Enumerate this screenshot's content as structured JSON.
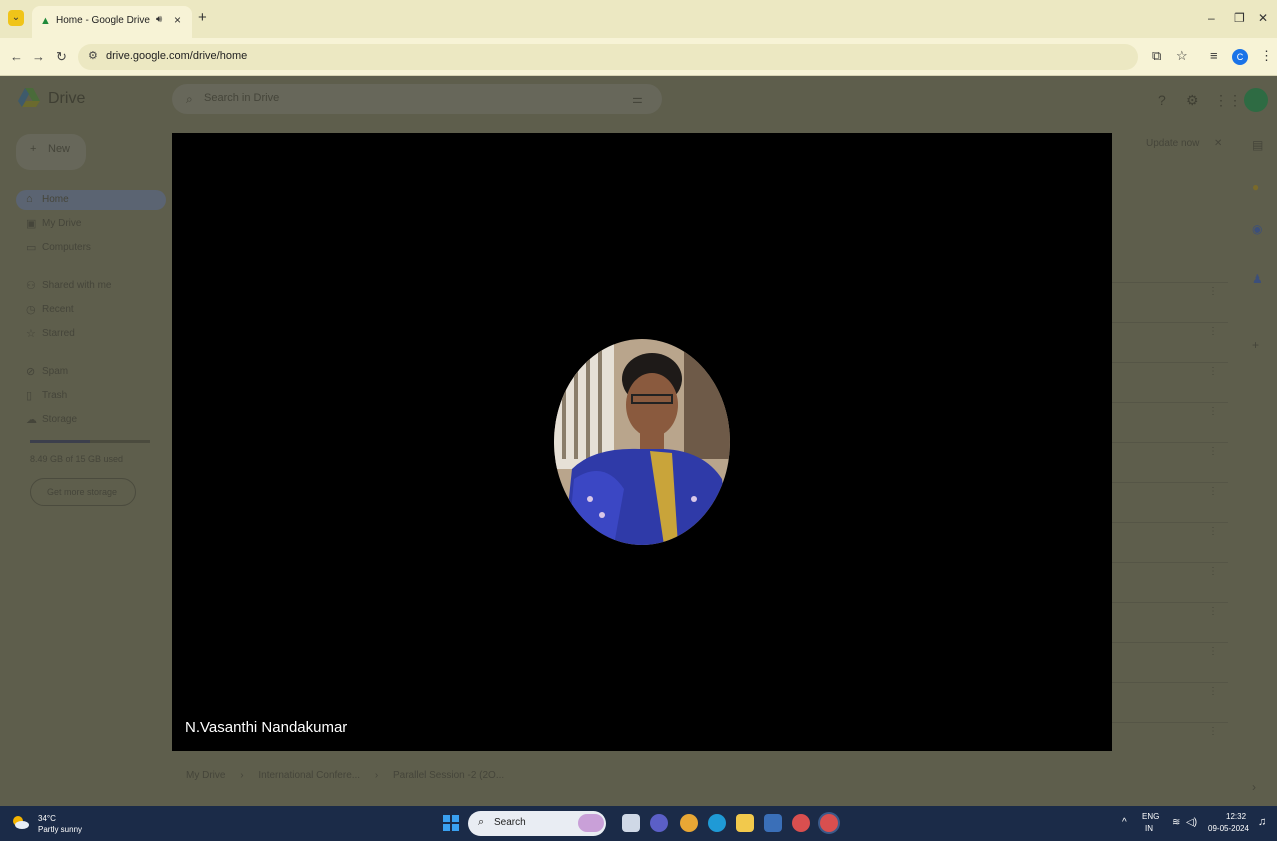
{
  "browser": {
    "tab_title": "Home - Google Drive",
    "tab_audio_icon": "speaker-icon",
    "url": "drive.google.com/drive/home",
    "window_controls": {
      "minimize": "–",
      "restore": "❐",
      "close": "✕"
    }
  },
  "drive": {
    "app_name": "Drive",
    "search_placeholder": "Search in Drive",
    "new_label": "New",
    "sidebar": [
      {
        "icon": "home-icon",
        "label": "Home"
      },
      {
        "icon": "my-drive-icon",
        "label": "My Drive"
      },
      {
        "icon": "computers-icon",
        "label": "Computers"
      },
      {
        "icon": "shared-icon",
        "label": "Shared with me"
      },
      {
        "icon": "recent-icon",
        "label": "Recent"
      },
      {
        "icon": "starred-icon",
        "label": "Starred"
      },
      {
        "icon": "spam-icon",
        "label": "Spam"
      },
      {
        "icon": "trash-icon",
        "label": "Trash"
      },
      {
        "icon": "storage-icon",
        "label": "Storage"
      }
    ],
    "storage_used": 0.5,
    "storage_text": "8.49 GB of 15 GB used",
    "storage_button": "Get more storage",
    "banner_update": "Update now",
    "breadcrumb": [
      "My Drive",
      "International Confere...",
      "Parallel Session -2 (2O..."
    ]
  },
  "video": {
    "speaker_name": "N.Vasanthi Nandakumar"
  },
  "taskbar": {
    "temperature": "34°C",
    "weather": "Partly sunny",
    "search_label": "Search",
    "lang_top": "ENG",
    "lang_bottom": "IN",
    "time": "12:32",
    "date": "09-05-2024"
  }
}
